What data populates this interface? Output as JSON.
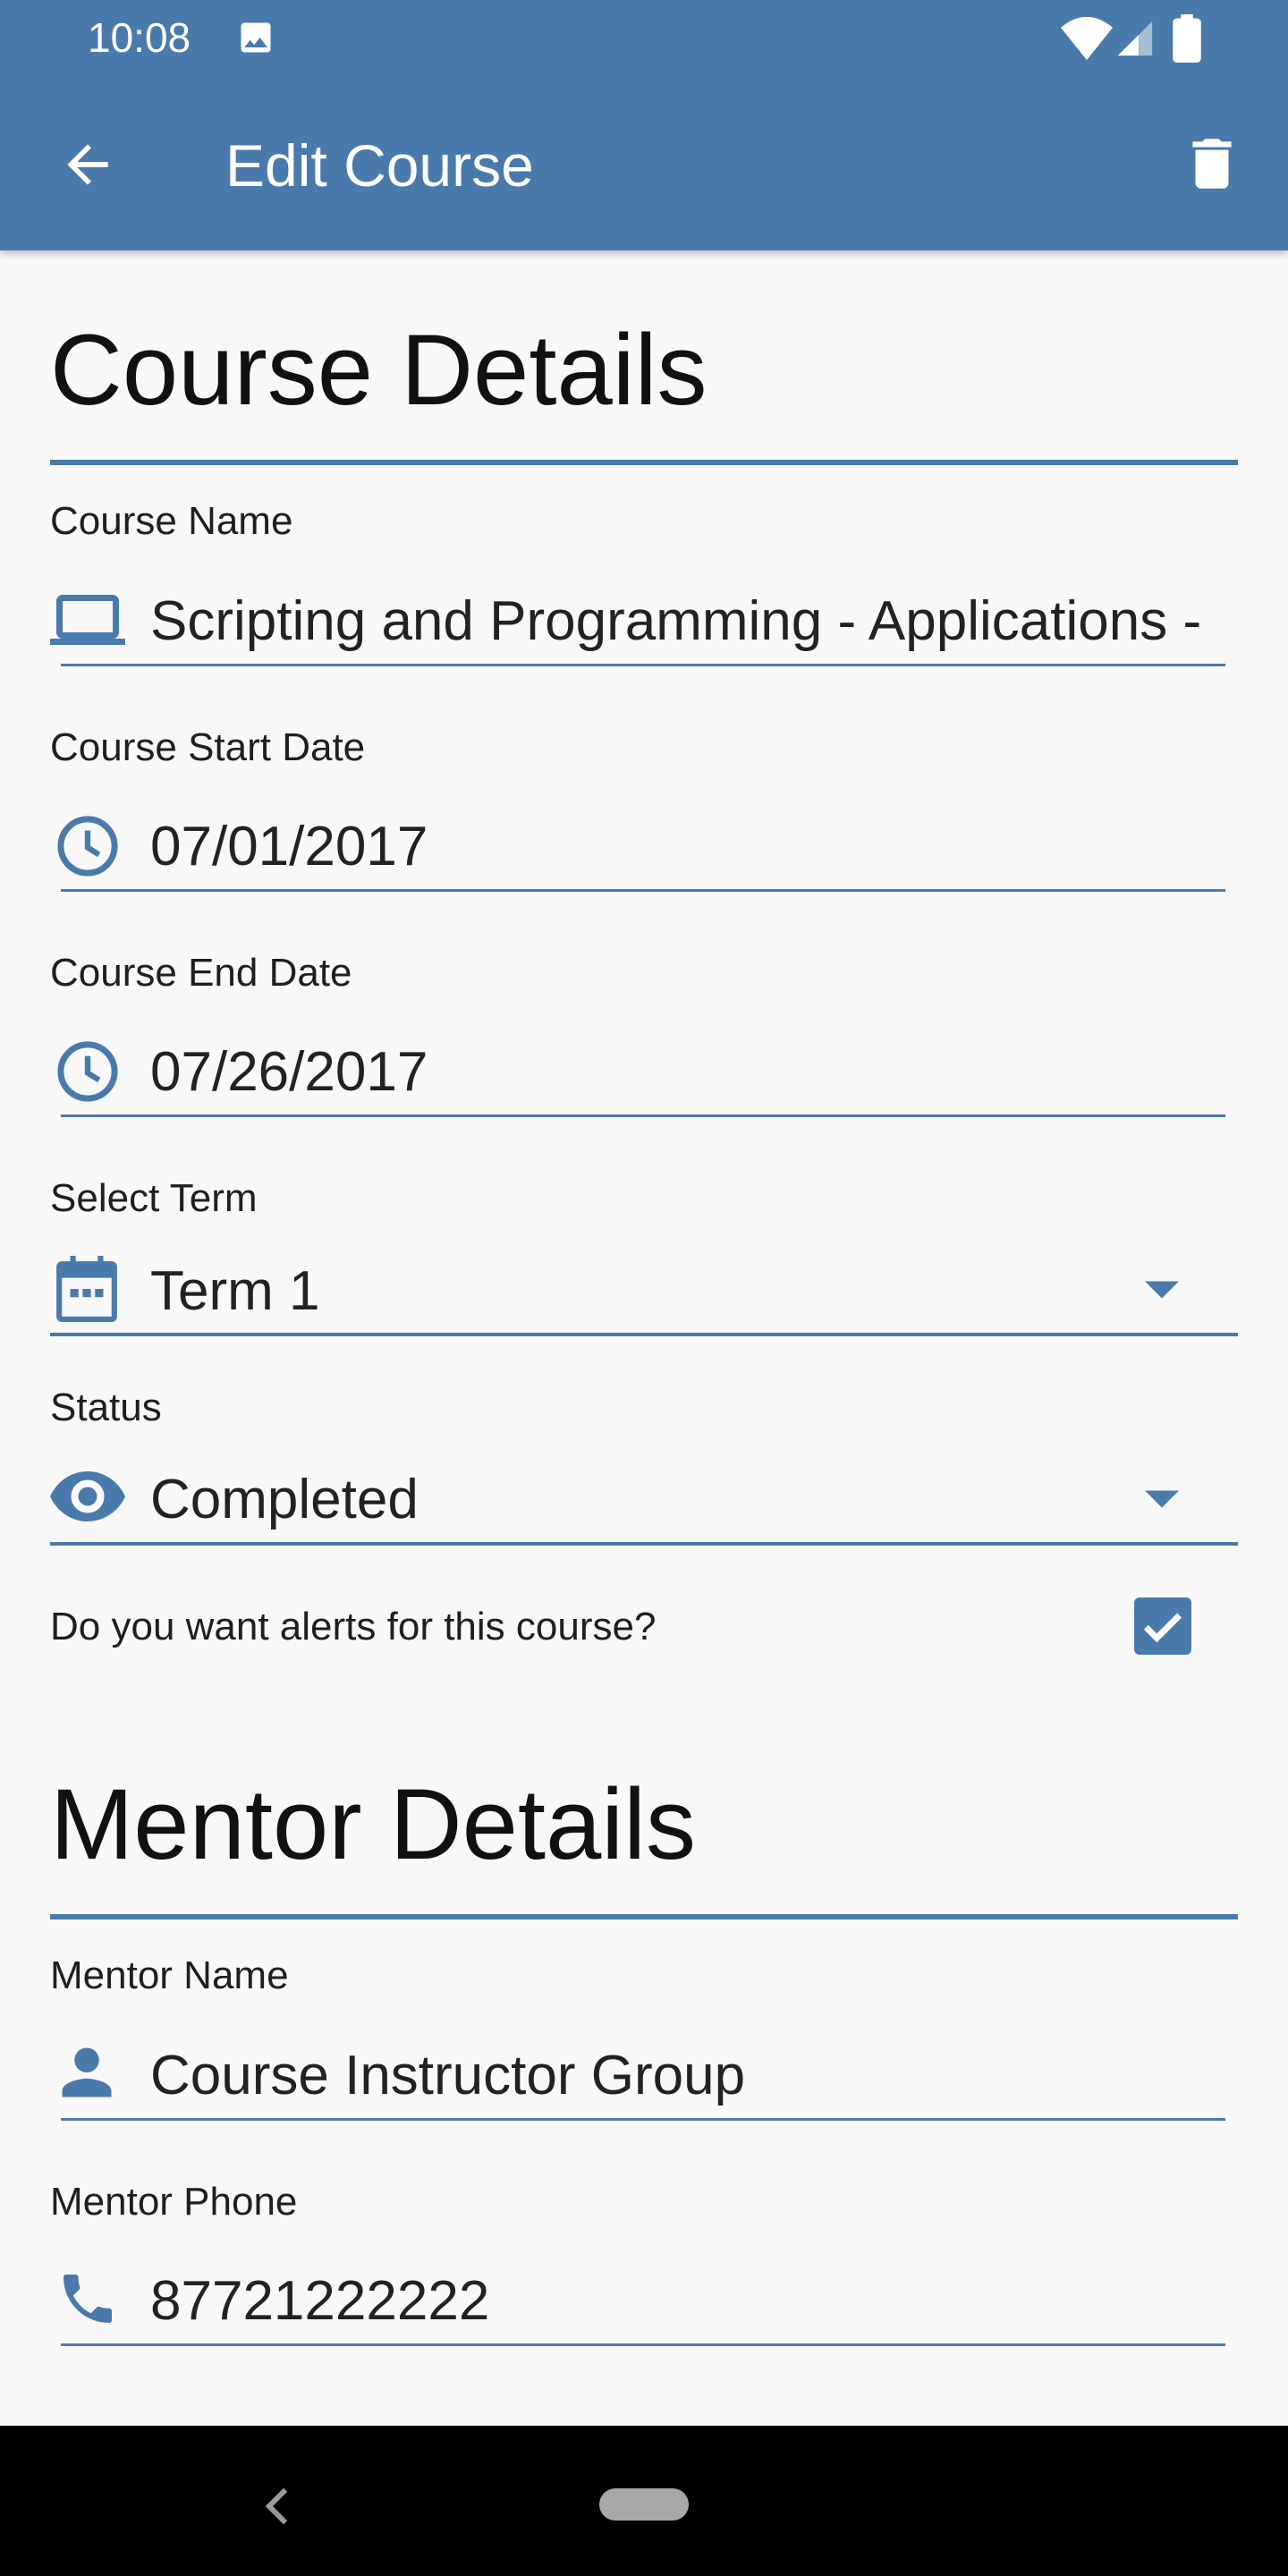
{
  "status_bar": {
    "time": "10:08"
  },
  "app_bar": {
    "title": "Edit Course"
  },
  "course_details": {
    "heading": "Course Details",
    "course_name": {
      "label": "Course Name",
      "value": "Scripting and Programming - Applications -"
    },
    "start_date": {
      "label": "Course Start Date",
      "value": "07/01/2017"
    },
    "end_date": {
      "label": "Course End Date",
      "value": "07/26/2017"
    },
    "term": {
      "label": "Select Term",
      "value": "Term 1"
    },
    "status": {
      "label": "Status",
      "value": "Completed"
    },
    "alerts": {
      "label": "Do you want alerts for this course?",
      "checked": true
    }
  },
  "mentor_details": {
    "heading": "Mentor Details",
    "mentor_name": {
      "label": "Mentor Name",
      "value": "Course Instructor Group"
    },
    "mentor_phone": {
      "label": "Mentor Phone",
      "value": "87721222222"
    }
  },
  "colors": {
    "primary": "#4a7aab",
    "background": "#f8f8f8",
    "nav_bar": "#000000"
  },
  "icons": {
    "back": "arrow-left-icon",
    "delete": "trash-icon",
    "course_name": "laptop-icon",
    "dates": "clock-icon",
    "term": "calendar-icon",
    "status": "eye-icon",
    "mentor_name": "person-icon",
    "mentor_phone": "phone-icon"
  }
}
